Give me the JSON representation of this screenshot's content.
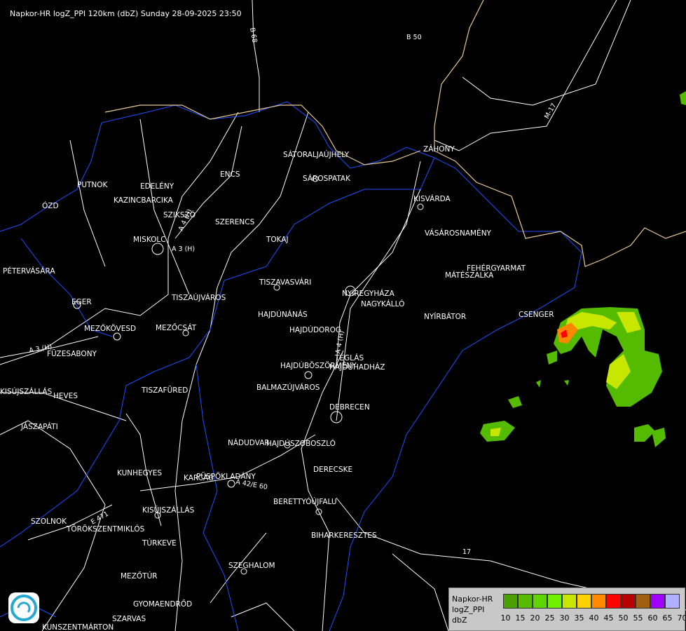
{
  "header": {
    "title": "Napkor-HR logZ_PPI 120km (dbZ) Sunday 28-09-2025 23:50"
  },
  "cities": [
    {
      "name": "SÁTORALJAÚJHELY"
    },
    {
      "name": "SÁROSPATAK"
    },
    {
      "name": "ZÁHONY"
    },
    {
      "name": "PUTNOK"
    },
    {
      "name": "EDELÉNY"
    },
    {
      "name": "ENCS"
    },
    {
      "name": "KAZINCBARCIKA"
    },
    {
      "name": "ÓZD"
    },
    {
      "name": "SZIKSZÓ"
    },
    {
      "name": "SZERENCS"
    },
    {
      "name": "KISVÁRDA"
    },
    {
      "name": "TOKAJ"
    },
    {
      "name": "MISKOLC"
    },
    {
      "name": "VÁSÁROSNAMÉNY"
    },
    {
      "name": "PÉTERVÁSÁRA"
    },
    {
      "name": "FEHÉRGYARMAT"
    },
    {
      "name": "MÁTÉSZALKA"
    },
    {
      "name": "TISZAVASVÁRI"
    },
    {
      "name": "NYÍREGYHÁZA"
    },
    {
      "name": "EGER"
    },
    {
      "name": "TISZAÚJVÁROS"
    },
    {
      "name": "NAGYKÁLLÓ"
    },
    {
      "name": "HAJDÚNÁNÁS"
    },
    {
      "name": "NYÍRBÁTOR"
    },
    {
      "name": "CSENGER"
    },
    {
      "name": "MEZŐKÖVESD"
    },
    {
      "name": "MEZŐCSÁT"
    },
    {
      "name": "HAJDÚDOROG"
    },
    {
      "name": "FÜZESABONY"
    },
    {
      "name": "TÉGLÁS"
    },
    {
      "name": "HAJDÚBÖSZÖRMÉNY"
    },
    {
      "name": "HAJDÚHADHÁZ"
    },
    {
      "name": "BALMAZÚJVÁROS"
    },
    {
      "name": "TISZAFÜRED"
    },
    {
      "name": "KISÚJSZÁLLÁS"
    },
    {
      "name": "HEVES"
    },
    {
      "name": "DEBRECEN"
    },
    {
      "name": "JÁSZAPÁTI"
    },
    {
      "name": "NÁDUDVAR"
    },
    {
      "name": "HAJDÚSZOBOSZLÓ"
    },
    {
      "name": "KUNHEGYES"
    },
    {
      "name": "DERECSKE"
    },
    {
      "name": "KARCAG"
    },
    {
      "name": "PÜSPÖKLADÁNY"
    },
    {
      "name": "BERETTYÓÚJFALU"
    },
    {
      "name": "KISÚJSZÁLLÁS"
    },
    {
      "name": "SZOLNOK"
    },
    {
      "name": "TÖRÖKSZENTMIKLÓS"
    },
    {
      "name": "BIHARKERESZTES"
    },
    {
      "name": "TÚRKEVE"
    },
    {
      "name": "SZEGHALOM"
    },
    {
      "name": "MEZŐTÚR"
    },
    {
      "name": "GYOMAENDRŐD"
    },
    {
      "name": "SZARVAS"
    },
    {
      "name": "KUNSZENTMÁRTON"
    }
  ],
  "roads": [
    {
      "name": "B 68"
    },
    {
      "name": "B 50"
    },
    {
      "name": "M-17"
    },
    {
      "name": "A 4 (H)"
    },
    {
      "name": "A 3 (H)"
    },
    {
      "name": "A 4 (H)"
    },
    {
      "name": "A 3 (H)"
    },
    {
      "name": "A 42/E 60"
    },
    {
      "name": "E 471"
    },
    {
      "name": "17"
    }
  ],
  "legend": {
    "title_lines": [
      "Napkor-HR",
      "logZ_PPI",
      "dbZ"
    ],
    "colors": [
      "#4aa000",
      "#55bb00",
      "#5fd400",
      "#6ef000",
      "#c8e600",
      "#ffd000",
      "#ff8800",
      "#ff0000",
      "#b80000",
      "#a06010",
      "#a000ff",
      "#b0b0ff"
    ],
    "ticks": [
      "10",
      "15",
      "20",
      "25",
      "30",
      "35",
      "40",
      "45",
      "50",
      "55",
      "60",
      "65",
      "70"
    ]
  },
  "colors": {
    "border": "#e8c890",
    "river": "#2050ff",
    "line": "#ffffff"
  }
}
